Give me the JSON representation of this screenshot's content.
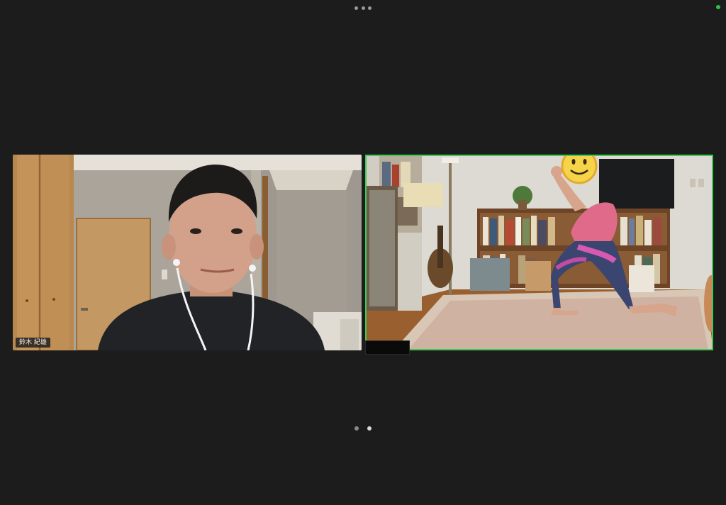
{
  "app": {
    "more_menu_icon": "more-horizontal-icon",
    "status_color": "#2ec24a"
  },
  "gallery": {
    "participants": [
      {
        "name": "鈴木 紀雄",
        "active_speaker": false
      },
      {
        "name": "",
        "name_redacted": true,
        "active_speaker": true,
        "face_covered_by": "smiley-emoji-icon"
      }
    ],
    "active_speaker_color": "#3ccb54"
  },
  "pagination": {
    "pages": 2,
    "current_page": 2
  }
}
